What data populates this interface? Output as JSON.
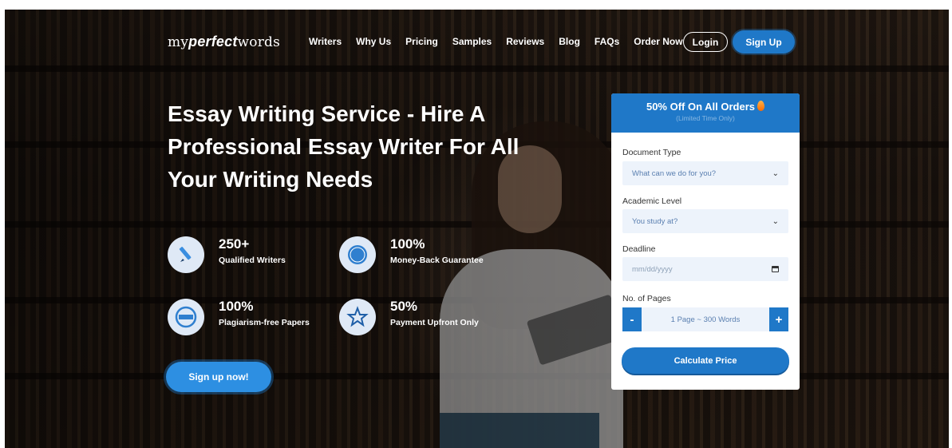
{
  "brand": {
    "prefix": "my",
    "bold": "perfect",
    "suffix": "words"
  },
  "nav": {
    "items": [
      "Writers",
      "Why Us",
      "Pricing",
      "Samples",
      "Reviews",
      "Blog",
      "FAQs",
      "Order Now"
    ],
    "login": "Login",
    "signup": "Sign Up"
  },
  "hero": {
    "title": "Essay Writing Service - Hire A Professional Essay Writer For All Your Writing Needs",
    "features": [
      {
        "number": "250+",
        "label": "Qualified Writers",
        "icon": "pen-icon"
      },
      {
        "number": "100%",
        "label": "Money-Back Guarantee",
        "icon": "money-back-badge-icon"
      },
      {
        "number": "100%",
        "label": "Plagiarism-free Papers",
        "icon": "authentic-badge-icon"
      },
      {
        "number": "50%",
        "label": "Payment Upfront Only",
        "icon": "star-icon"
      }
    ],
    "cta": "Sign up now!"
  },
  "order_form": {
    "offer": "50% Off On All Orders",
    "limited": "(Limited Time Only)",
    "document_type": {
      "label": "Document Type",
      "placeholder": "What can we do for you?"
    },
    "academic_level": {
      "label": "Academic Level",
      "placeholder": "You study at?"
    },
    "deadline": {
      "label": "Deadline",
      "placeholder": "mm/dd/yyyy"
    },
    "pages": {
      "label": "No. of Pages",
      "value": "1 Page ~ 300 Words",
      "minus": "-",
      "plus": "+"
    },
    "submit": "Calculate Price"
  },
  "colors": {
    "accent": "#1f78c8",
    "field_bg": "#edf3fb",
    "text_dark": "#333333"
  }
}
